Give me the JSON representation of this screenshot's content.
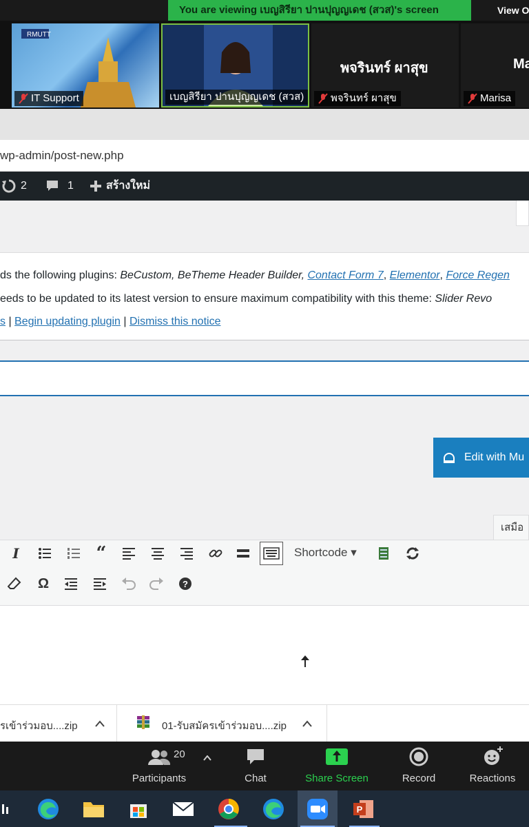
{
  "zoom_banner": {
    "viewing_text": "You are viewing เบญสิรียา ปานปุญญเดช (สวส)'s screen",
    "view_options": "View Options"
  },
  "participants_strip": [
    {
      "name": "IT Support"
    },
    {
      "name": "เบญสิรียา ปานปุญญเดช (สวส)"
    },
    {
      "name": "พจรินทร์ ผาสุข",
      "big_label": "พจรินทร์ ผาสุข"
    },
    {
      "name": "Marisa",
      "big_label": "Ma"
    }
  ],
  "browser": {
    "url": "wp-admin/post-new.php"
  },
  "admin_bar": {
    "updates_count": "2",
    "comments_count": "1",
    "new_label": "สร้างใหม่"
  },
  "notice": {
    "line1_prefix": "ds the following plugins: ",
    "line1_plugins_plain": "BeCustom, BeTheme Header Builder, ",
    "link_cf7": "Contact Form 7",
    "link_elementor": "Elementor",
    "link_force": "Force Regen",
    "line2": "eeds to be updated to its latest version to ensure maximum compatibility with this theme: ",
    "line2_plugin": "Slider Revo",
    "link_begin_prefix": "s",
    "link_begin": "Begin updating plugin",
    "link_dismiss": "Dismiss this notice"
  },
  "editor": {
    "edit_button": "Edit with Mu",
    "visual_tab": "เสมือ",
    "shortcode_label": "Shortcode ▾"
  },
  "downloads": [
    {
      "name": "รเข้าร่วมอบ....zip"
    },
    {
      "name": "01-รับสมัครเข้าร่วมอบ....zip"
    }
  ],
  "zoom_controls": {
    "participants_count": "20",
    "participants": "Participants",
    "chat": "Chat",
    "share": "Share Screen",
    "record": "Record",
    "reactions": "Reactions"
  },
  "colors": {
    "banner_green": "#2bb34a",
    "wp_blue": "#2271b1",
    "edit_button": "#1a7fbf"
  }
}
